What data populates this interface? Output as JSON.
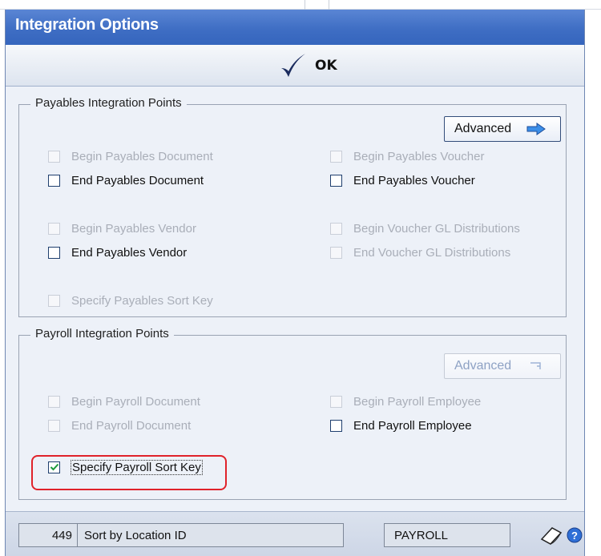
{
  "window": {
    "title": "Integration Options"
  },
  "toolbar": {
    "ok_label": "OK",
    "ok_icon": "checkmark-icon"
  },
  "payables": {
    "legend": "Payables Integration Points",
    "advanced_label": "Advanced",
    "advanced_enabled": true,
    "checkboxes": [
      {
        "label": "Begin Payables Document",
        "checked": false,
        "enabled": false
      },
      {
        "label": "End Payables Document",
        "checked": false,
        "enabled": true
      },
      {
        "label": "Begin Payables Vendor",
        "checked": false,
        "enabled": false
      },
      {
        "label": "End Payables Vendor",
        "checked": false,
        "enabled": true
      },
      {
        "label": "Specify Payables Sort Key",
        "checked": false,
        "enabled": false
      },
      {
        "label": "Begin Payables Voucher",
        "checked": false,
        "enabled": false
      },
      {
        "label": "End Payables Voucher",
        "checked": false,
        "enabled": true
      },
      {
        "label": "Begin Voucher GL Distributions",
        "checked": false,
        "enabled": false
      },
      {
        "label": "End Voucher GL Distributions",
        "checked": false,
        "enabled": false
      }
    ]
  },
  "payroll": {
    "legend": "Payroll Integration Points",
    "advanced_label": "Advanced",
    "advanced_enabled": false,
    "checkboxes": [
      {
        "label": "Begin Payroll Document",
        "checked": false,
        "enabled": false
      },
      {
        "label": "End Payroll Document",
        "checked": false,
        "enabled": false
      },
      {
        "label": "Specify Payroll Sort Key",
        "checked": true,
        "enabled": true,
        "highlighted": true
      },
      {
        "label": "Begin Payroll Employee",
        "checked": false,
        "enabled": false
      },
      {
        "label": "End Payroll Employee",
        "checked": false,
        "enabled": true
      }
    ]
  },
  "statusbar": {
    "number": "449",
    "description": "Sort by Location ID",
    "module": "PAYROLL",
    "icons": [
      "note-icon",
      "help-icon"
    ]
  },
  "colors": {
    "titlebar": "#3f6ec4",
    "highlight": "#e0222a",
    "check": "#1c9a3b"
  }
}
